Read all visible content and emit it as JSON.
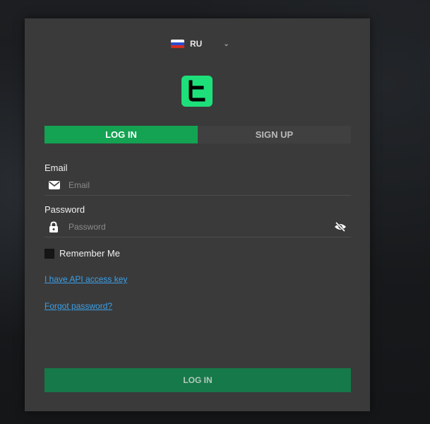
{
  "language": {
    "code": "RU",
    "flag": "russia-flag"
  },
  "brand": {
    "logo": "app-logo",
    "color": "#1ee07a"
  },
  "tabs": [
    {
      "label": "LOG IN",
      "active": true
    },
    {
      "label": "SIGN UP",
      "active": false
    }
  ],
  "email": {
    "label": "Email",
    "placeholder": "Email",
    "value": "",
    "icon": "envelope-icon"
  },
  "password": {
    "label": "Password",
    "placeholder": "Password",
    "value": "",
    "icon": "lock-icon",
    "toggle_icon": "eye-off-icon"
  },
  "remember": {
    "label": "Remember Me",
    "checked": false
  },
  "links": {
    "api_key": "I have API access key",
    "forgot": "Forgot password?"
  },
  "submit": {
    "label": "LOG IN"
  },
  "colors": {
    "accent": "#13a352",
    "submit_bg": "#16794a",
    "link": "#3aa0ea",
    "panel": "#3a3a3a"
  }
}
